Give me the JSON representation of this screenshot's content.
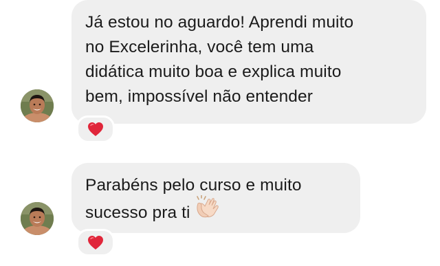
{
  "messages": [
    {
      "lines": [
        "Já estou no aguardo! Aprendi muito",
        "no Excelerinha, você tem uma",
        "didática muito boa e explica muito",
        "bem, impossível não entender"
      ],
      "reaction": "heart-icon",
      "avatar": "sender-avatar"
    },
    {
      "lines": [
        "Parabéns pelo curso e muito",
        "sucesso pra ti"
      ],
      "trailing_emoji": "clapping-hands-icon",
      "reaction": "heart-icon",
      "avatar": "sender-avatar"
    }
  ],
  "colors": {
    "bubble_bg": "#efefef",
    "text": "#1b1b1b",
    "heart": "#e0263a",
    "background": "#ffffff"
  }
}
